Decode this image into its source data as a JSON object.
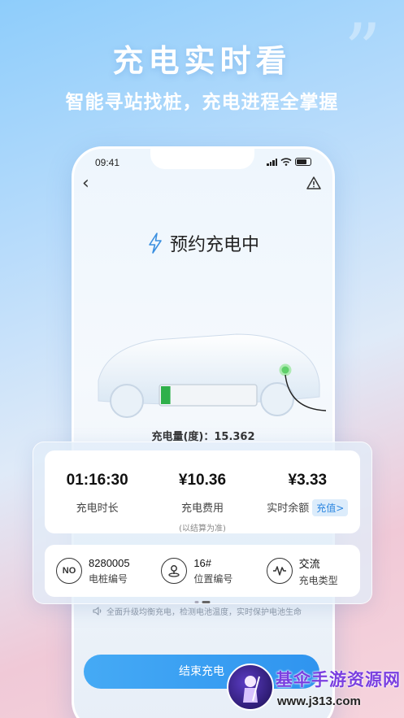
{
  "hero": {
    "title": "充电实时看",
    "subtitle": "智能寻站找桩，充电进程全掌握"
  },
  "status_bar": {
    "time": "09:41"
  },
  "page": {
    "charging_status": "预约充电中",
    "amount_label": "充电量(度)：15.362",
    "battery_level": 0.1
  },
  "stats": [
    {
      "value": "01:16:30",
      "label": "充电时长"
    },
    {
      "value": "¥10.36",
      "label": "充电费用",
      "note": "(以结算为准)"
    },
    {
      "value": "¥3.33",
      "label": "实时余额",
      "action": "充值>"
    }
  ],
  "info": [
    {
      "icon": "no-icon",
      "icon_text": "NO",
      "value": "8280005",
      "label": "电桩编号"
    },
    {
      "icon": "location-icon",
      "value": "16#",
      "label": "位置编号"
    },
    {
      "icon": "ac-wave-icon",
      "value": "交流",
      "label": "充电类型"
    }
  ],
  "tip": "全面升级均衡充电，检测电池温度，实时保护电池生命",
  "end_button": "结束充电",
  "watermark": {
    "title": "基伞手游资源网",
    "url": "www.j313.com"
  },
  "colors": {
    "accent": "#2f94ef",
    "battery": "#2fb04a",
    "topup": "#2b86e0"
  }
}
